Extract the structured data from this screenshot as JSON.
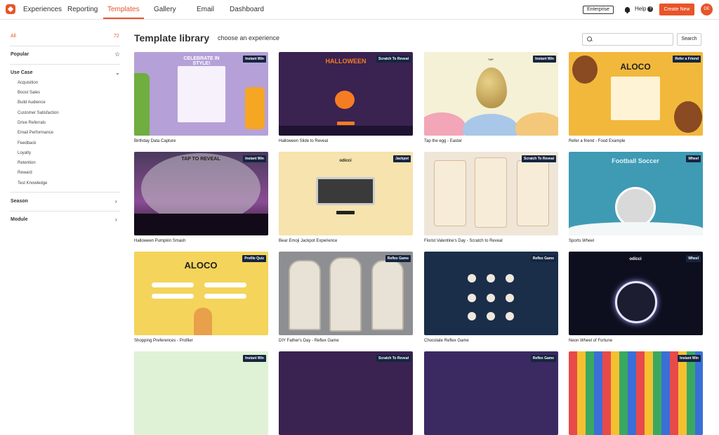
{
  "nav": {
    "items": [
      {
        "label": "Experiences",
        "active": false
      },
      {
        "label": "Reporting",
        "active": false
      },
      {
        "label": "Templates",
        "active": true
      },
      {
        "label": "Gallery",
        "active": false
      },
      {
        "label": "Email",
        "active": false
      },
      {
        "label": "Dashboard",
        "active": false
      }
    ],
    "plan_badge": "Enterprise",
    "help_label": "Help",
    "help_glyph": "?",
    "create_label": "Create New",
    "avatar_initials": "DE",
    "accent_color": "#e8542a"
  },
  "sidebar": {
    "all_label": "All",
    "all_count": "72",
    "popular_label": "Popular",
    "use_case_label": "Use Case",
    "use_cases": [
      "Acquisition",
      "Boost Sales",
      "Build Audience",
      "Customer Satisfaction",
      "Drive Referrals",
      "Email Performance",
      "Feedback",
      "Loyalty",
      "Retention",
      "Reward",
      "Test Knowledge"
    ],
    "season_label": "Season",
    "module_label": "Module"
  },
  "main": {
    "title": "Template library",
    "subtitle": "choose an experience",
    "search_placeholder": "",
    "search_button": "Search",
    "tag_color": "#152540"
  },
  "templates": [
    {
      "name": "Birthday Data Capture",
      "tag": "Instant Win",
      "thumb_text": "CELEBRATE IN STYLE!"
    },
    {
      "name": "Halloween Slide to Reveal",
      "tag": "Scratch To Reveal",
      "thumb_text": "HALLOWEEN"
    },
    {
      "name": "Tap the egg - Easter",
      "tag": "Instant Win",
      "thumb_text": "TAP"
    },
    {
      "name": "Refer a friend - Food Example",
      "tag": "Refer a Friend",
      "thumb_text": "ALOCO"
    },
    {
      "name": "Halloween Pumpkin Smash",
      "tag": "Instant Win",
      "thumb_text": "TAP TO REVEAL"
    },
    {
      "name": "Bear Emoji Jackpot Experience",
      "tag": "Jackpot",
      "thumb_text": "odicci"
    },
    {
      "name": "Florist Valentine's Day - Scratch to Reveal",
      "tag": "Scratch To Reveal",
      "thumb_text": ""
    },
    {
      "name": "Sports Wheel",
      "tag": "Wheel",
      "thumb_text": "Football Soccer"
    },
    {
      "name": "Shopping Preferences - Profiler",
      "tag": "Profile Quiz",
      "thumb_text": "ALOCO"
    },
    {
      "name": "DIY Father's Day - Reflex Game",
      "tag": "Reflex Game",
      "thumb_text": ""
    },
    {
      "name": "Chocolate Reflex Game",
      "tag": "Reflex Game",
      "thumb_text": ""
    },
    {
      "name": "Neon Wheel of Fortune",
      "tag": "Wheel",
      "thumb_text": "odicci"
    },
    {
      "name": "",
      "tag": "Instant Win",
      "thumb_text": ""
    },
    {
      "name": "",
      "tag": "Scratch To Reveal",
      "thumb_text": ""
    },
    {
      "name": "",
      "tag": "Reflex Game",
      "thumb_text": ""
    },
    {
      "name": "",
      "tag": "Instant Win",
      "thumb_text": ""
    }
  ]
}
